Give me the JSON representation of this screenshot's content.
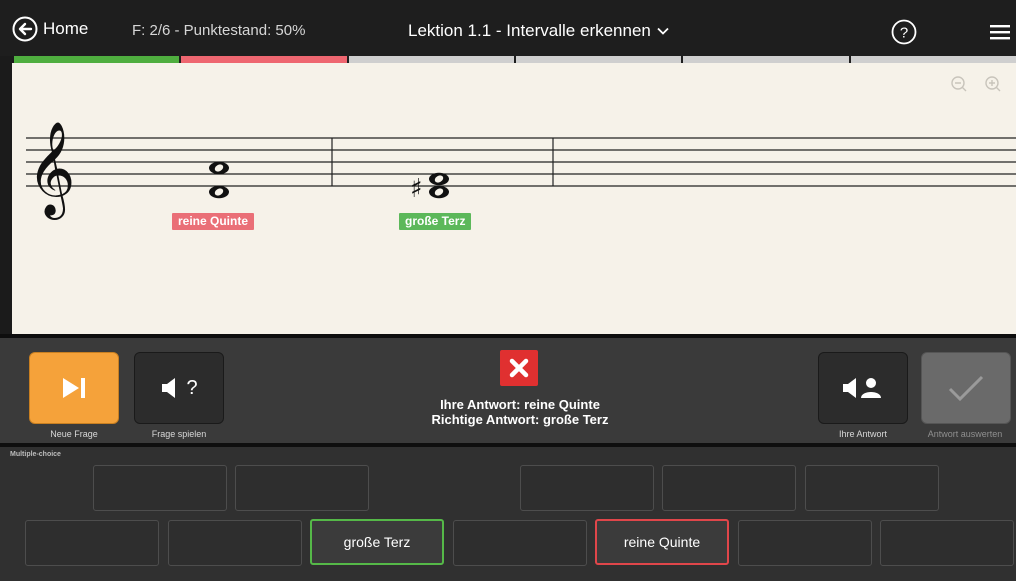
{
  "topbar": {
    "home_label": "Home",
    "score_text": "F: 2/6 - Punktestand: 50%",
    "lesson_title": "Lektion 1.1 - Intervalle erkennen"
  },
  "progress": {
    "segments": [
      "correct",
      "wrong",
      "pending",
      "pending",
      "pending",
      "pending"
    ],
    "colors": {
      "correct": "#4fae3f",
      "wrong": "#ee6670",
      "pending": "#cfcfcf"
    }
  },
  "score": {
    "clef": "treble",
    "measures": [
      {
        "notes": "C5 + G5",
        "tag": "reine Quinte",
        "tag_color": "#ea6f77"
      },
      {
        "notes": "C5 + E#5? (sharp)",
        "tag": "große Terz",
        "tag_color": "#5cb85a"
      }
    ],
    "accidental": "♯"
  },
  "controls": {
    "new_question_label": "Neue Frage",
    "play_question_label": "Frage spielen",
    "play_question_symbol": "?",
    "your_answer_label": "Ihre Antwort",
    "evaluate_label": "Antwort auswerten",
    "result_line1": "Ihre Antwort: reine Quinte",
    "result_line2": "Richtige Antwort: große Terz",
    "colors": {
      "new_question": "#f5a23a",
      "result_x": "#e03030"
    }
  },
  "multiple_choice": {
    "title": "Multiple-choice",
    "row1": [
      "",
      "",
      "",
      "",
      ""
    ],
    "row2": [
      "",
      "",
      "große Terz",
      "",
      "reine Quinte",
      "",
      ""
    ],
    "correct": "große Terz",
    "selected_wrong": "reine Quinte"
  }
}
